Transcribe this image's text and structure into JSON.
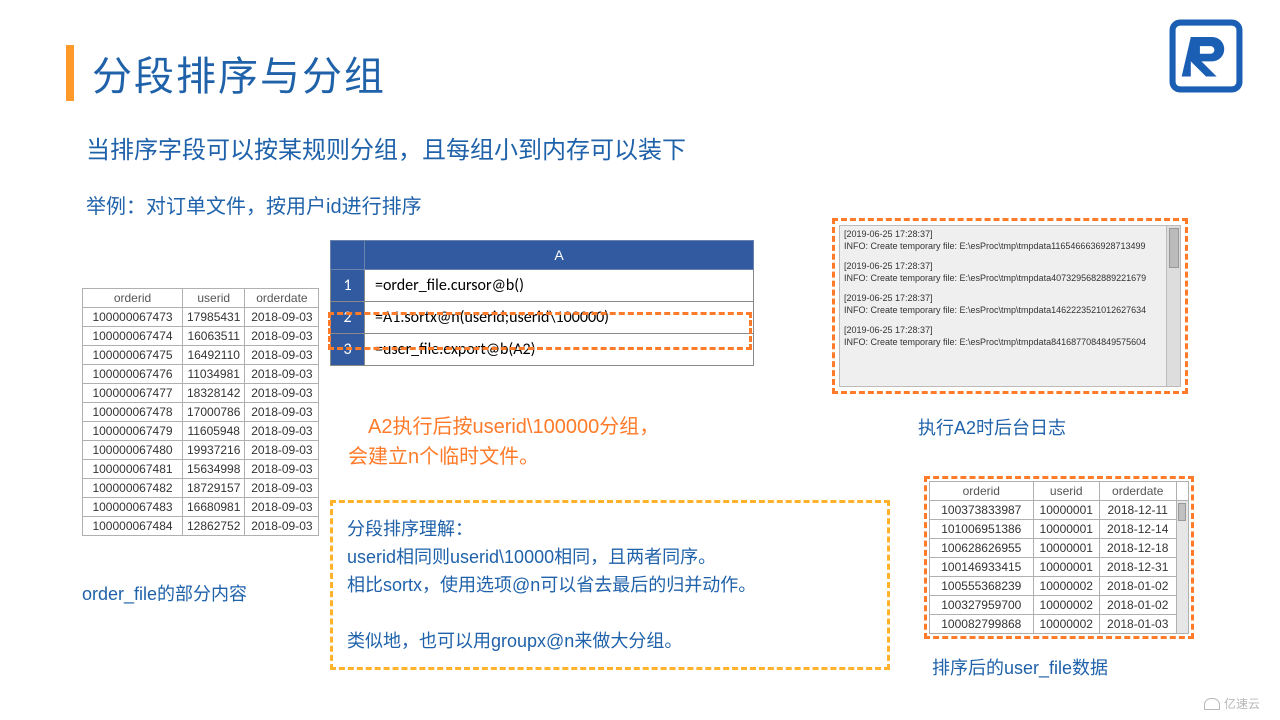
{
  "header": {
    "title": "分段排序与分组"
  },
  "subtitle": "当排序字段可以按某规则分组，且每组小到内存可以装下",
  "example": "举例：对订单文件，按用户id进行排序",
  "order_table": {
    "columns": [
      "orderid",
      "userid",
      "orderdate"
    ],
    "rows": [
      [
        "100000067473",
        "17985431",
        "2018-09-03"
      ],
      [
        "100000067474",
        "16063511",
        "2018-09-03"
      ],
      [
        "100000067475",
        "16492110",
        "2018-09-03"
      ],
      [
        "100000067476",
        "11034981",
        "2018-09-03"
      ],
      [
        "100000067477",
        "18328142",
        "2018-09-03"
      ],
      [
        "100000067478",
        "17000786",
        "2018-09-03"
      ],
      [
        "100000067479",
        "11605948",
        "2018-09-03"
      ],
      [
        "100000067480",
        "19937216",
        "2018-09-03"
      ],
      [
        "100000067481",
        "15634998",
        "2018-09-03"
      ],
      [
        "100000067482",
        "18729157",
        "2018-09-03"
      ],
      [
        "100000067483",
        "16680981",
        "2018-09-03"
      ],
      [
        "100000067484",
        "12862752",
        "2018-09-03"
      ]
    ]
  },
  "caption1": "order_file的部分内容",
  "code": {
    "header_row": "",
    "col_a": "A",
    "rows": [
      {
        "n": "1",
        "a": "=order_file.cursor@b()"
      },
      {
        "n": "2",
        "a": "=A1.sortx@n(userid;userid\\100000)"
      },
      {
        "n": "3",
        "a": "=user_file.export@b(A2)"
      }
    ]
  },
  "note_a2_l1": "A2执行后按userid\\100000分组，",
  "note_a2_l2": "会建立n个临时文件。",
  "explain": {
    "l1": "分段排序理解：",
    "l2": "userid相同则userid\\10000相同，且两者同序。",
    "l3": "相比sortx，使用选项@n可以省去最后的归并动作。",
    "l4": "类似地，也可以用groupx@n来做大分组。"
  },
  "log": {
    "entries": [
      {
        "ts": "[2019-06-25 17:28:37]",
        "msg": "INFO: Create temporary file: E:\\esProc\\tmp\\tmpdata1165466636928713499"
      },
      {
        "ts": "[2019-06-25 17:28:37]",
        "msg": "INFO: Create temporary file: E:\\esProc\\tmp\\tmpdata4073295682889221679"
      },
      {
        "ts": "[2019-06-25 17:28:37]",
        "msg": "INFO: Create temporary file: E:\\esProc\\tmp\\tmpdata1462223521012627634"
      },
      {
        "ts": "[2019-06-25 17:28:37]",
        "msg": "INFO: Create temporary file: E:\\esProc\\tmp\\tmpdata8416877084849575604"
      }
    ]
  },
  "caption2": "执行A2时后台日志",
  "result_table": {
    "columns": [
      "orderid",
      "userid",
      "orderdate"
    ],
    "rows": [
      [
        "100373833987",
        "10000001",
        "2018-12-11"
      ],
      [
        "101006951386",
        "10000001",
        "2018-12-14"
      ],
      [
        "100628626955",
        "10000001",
        "2018-12-18"
      ],
      [
        "100146933415",
        "10000001",
        "2018-12-31"
      ],
      [
        "100555368239",
        "10000002",
        "2018-01-02"
      ],
      [
        "100327959700",
        "10000002",
        "2018-01-02"
      ],
      [
        "100082799868",
        "10000002",
        "2018-01-03"
      ]
    ]
  },
  "caption3": "排序后的user_file数据",
  "watermark": "亿速云"
}
